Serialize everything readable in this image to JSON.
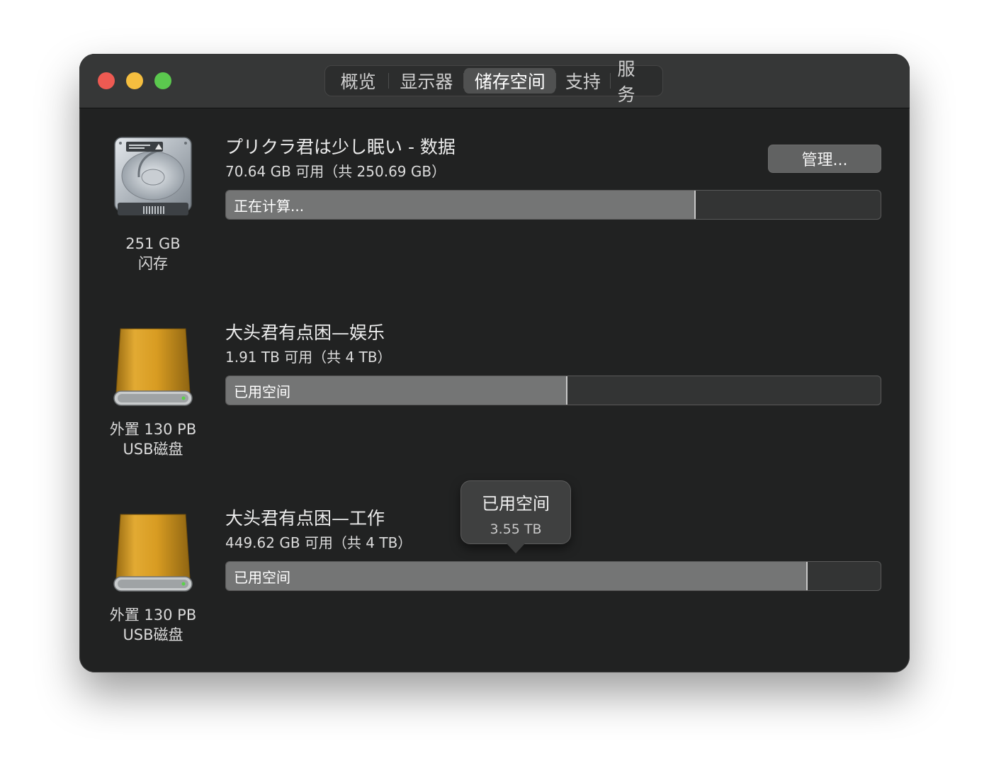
{
  "window": {
    "tabs": [
      {
        "label": "概览"
      },
      {
        "label": "显示器"
      },
      {
        "label": "储存空间"
      },
      {
        "label": "支持"
      },
      {
        "label": "服务"
      }
    ],
    "active_tab": "储存空间"
  },
  "drives": [
    {
      "name": "プリクラ君は少し眠い - 数据",
      "available": "70.64 GB 可用（共 250.69 GB）",
      "size_line1": "251 GB",
      "size_line2": "闪存",
      "bar_label": "正在计算...",
      "used_fraction": 0.718,
      "icon": "internal-disk-icon"
    },
    {
      "name": "大头君有点困—娱乐",
      "available": "1.91 TB 可用（共 4 TB）",
      "size_line1": "外置 130 PB",
      "size_line2": "USB磁盘",
      "bar_label": "已用空间",
      "used_fraction": 0.522,
      "icon": "external-disk-icon"
    },
    {
      "name": "大头君有点困—工作",
      "available": "449.62 GB 可用（共 4 TB）",
      "size_line1": "外置 130 PB",
      "size_line2": "USB磁盘",
      "bar_label": "已用空间",
      "used_fraction": 0.888,
      "icon": "external-disk-icon"
    }
  ],
  "manage_button": "管理...",
  "tooltip": {
    "title": "已用空间",
    "value": "3.55 TB"
  },
  "colors": {
    "bar_fill": "#747575",
    "bar_empty": "#333434",
    "external_disk": "#d79e1e",
    "close": "#ee5a52",
    "minimize": "#f5be3f",
    "zoom": "#5bc84e"
  }
}
